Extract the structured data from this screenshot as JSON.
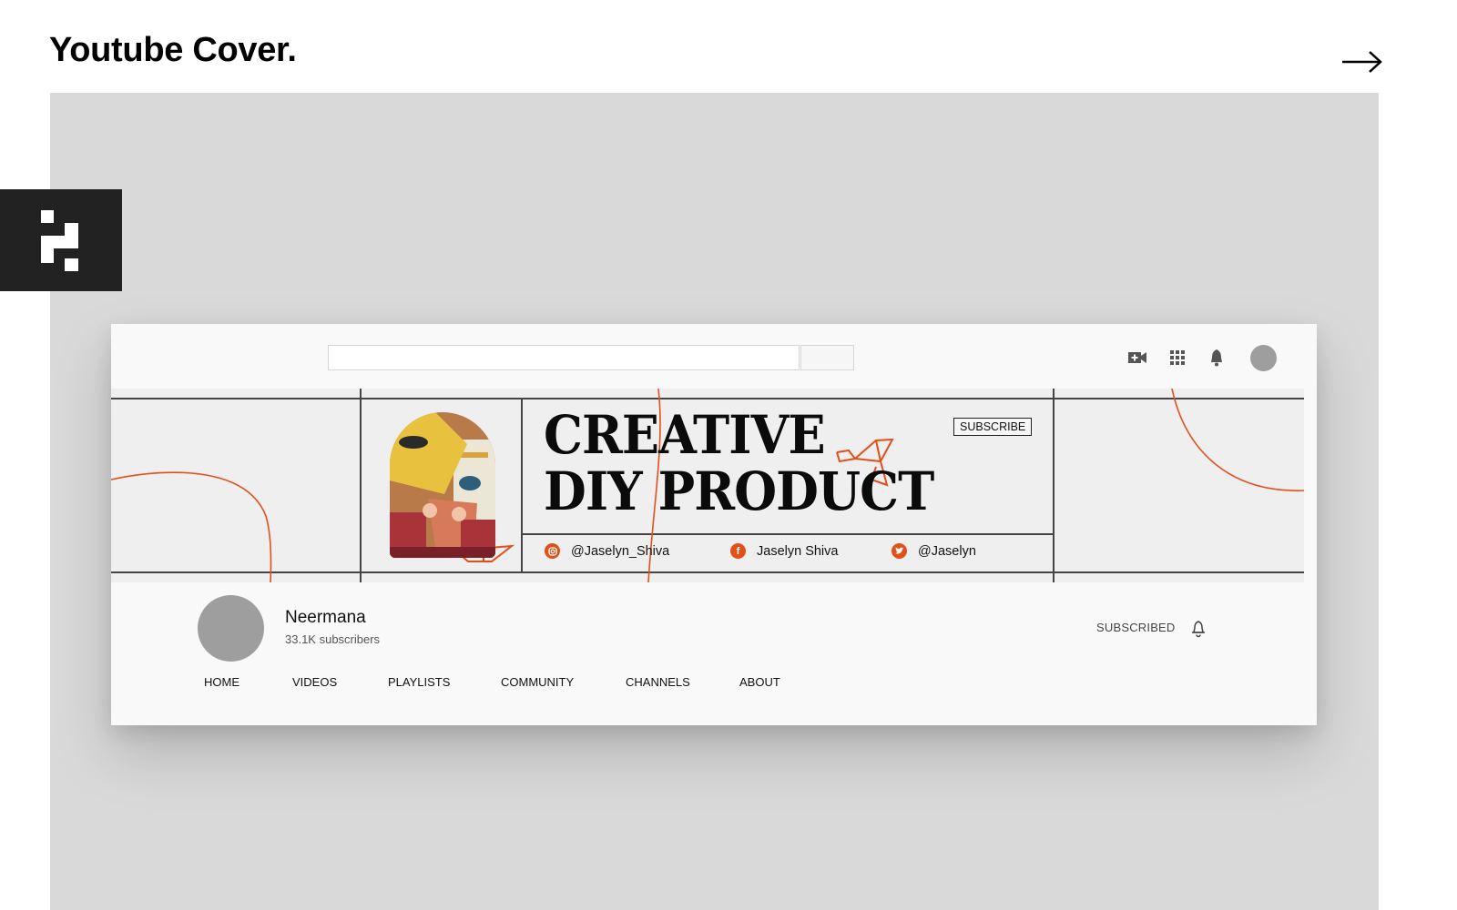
{
  "page": {
    "title": "Youtube Cover.",
    "next_icon": "arrow-right-icon",
    "logo_icon": "pixel-logo-icon"
  },
  "colors": {
    "accent": "#e2501a",
    "stage_bg": "#d9d9d9",
    "banner_bg": "#efefef",
    "logo_bg": "#222222",
    "avatar_gray": "#9e9e9e"
  },
  "youtube": {
    "search": {
      "placeholder": ""
    },
    "top_icons": [
      "create-video-icon",
      "apps-grid-icon",
      "notifications-bell-icon",
      "account-avatar"
    ],
    "banner": {
      "headline_line1": "CREATIVE",
      "headline_line2": "DIY PRODUCT",
      "subscribe_tag": "SUBSCRIBE",
      "socials": [
        {
          "icon": "instagram-icon",
          "handle": "@Jaselyn_Shiva"
        },
        {
          "icon": "facebook-icon",
          "handle": "Jaselyn Shiva"
        },
        {
          "icon": "twitter-icon",
          "handle": "@Jaselyn"
        }
      ]
    },
    "channel": {
      "name": "Neermana",
      "subscribers": "33.1K subscribers",
      "subscribed_label": "SUBSCRIBED"
    },
    "tabs": [
      "HOME",
      "VIDEOS",
      "PLAYLISTS",
      "COMMUNITY",
      "CHANNELS",
      "ABOUT"
    ]
  }
}
